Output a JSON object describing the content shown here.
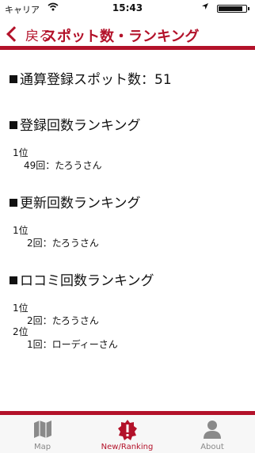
{
  "status_bar": {
    "carrier": "キャリア",
    "time": "15:43"
  },
  "nav": {
    "back_label": "戻る",
    "title": "スポット数・ランキング"
  },
  "total": {
    "label": "通算登録スポット数：",
    "value": "51"
  },
  "sections": [
    {
      "title": "登録回数ランキング",
      "entries": [
        {
          "rank": "1位",
          "detail": "49回：たろうさん"
        }
      ]
    },
    {
      "title": "更新回数ランキング",
      "entries": [
        {
          "rank": "1位",
          "detail": "2回：たろうさん"
        }
      ]
    },
    {
      "title": "ロコミ回数ランキング",
      "entries": [
        {
          "rank": "1位",
          "detail": "2回：たろうさん"
        },
        {
          "rank": "2位",
          "detail": "1回：ローディーさん"
        }
      ]
    }
  ],
  "tabs": [
    {
      "label": "Map",
      "icon": "map-icon"
    },
    {
      "label": "New/Ranking",
      "icon": "alert-badge-icon"
    },
    {
      "label": "About",
      "icon": "person-icon"
    }
  ],
  "colors": {
    "accent": "#b3122a",
    "tab_inactive": "#888888"
  }
}
